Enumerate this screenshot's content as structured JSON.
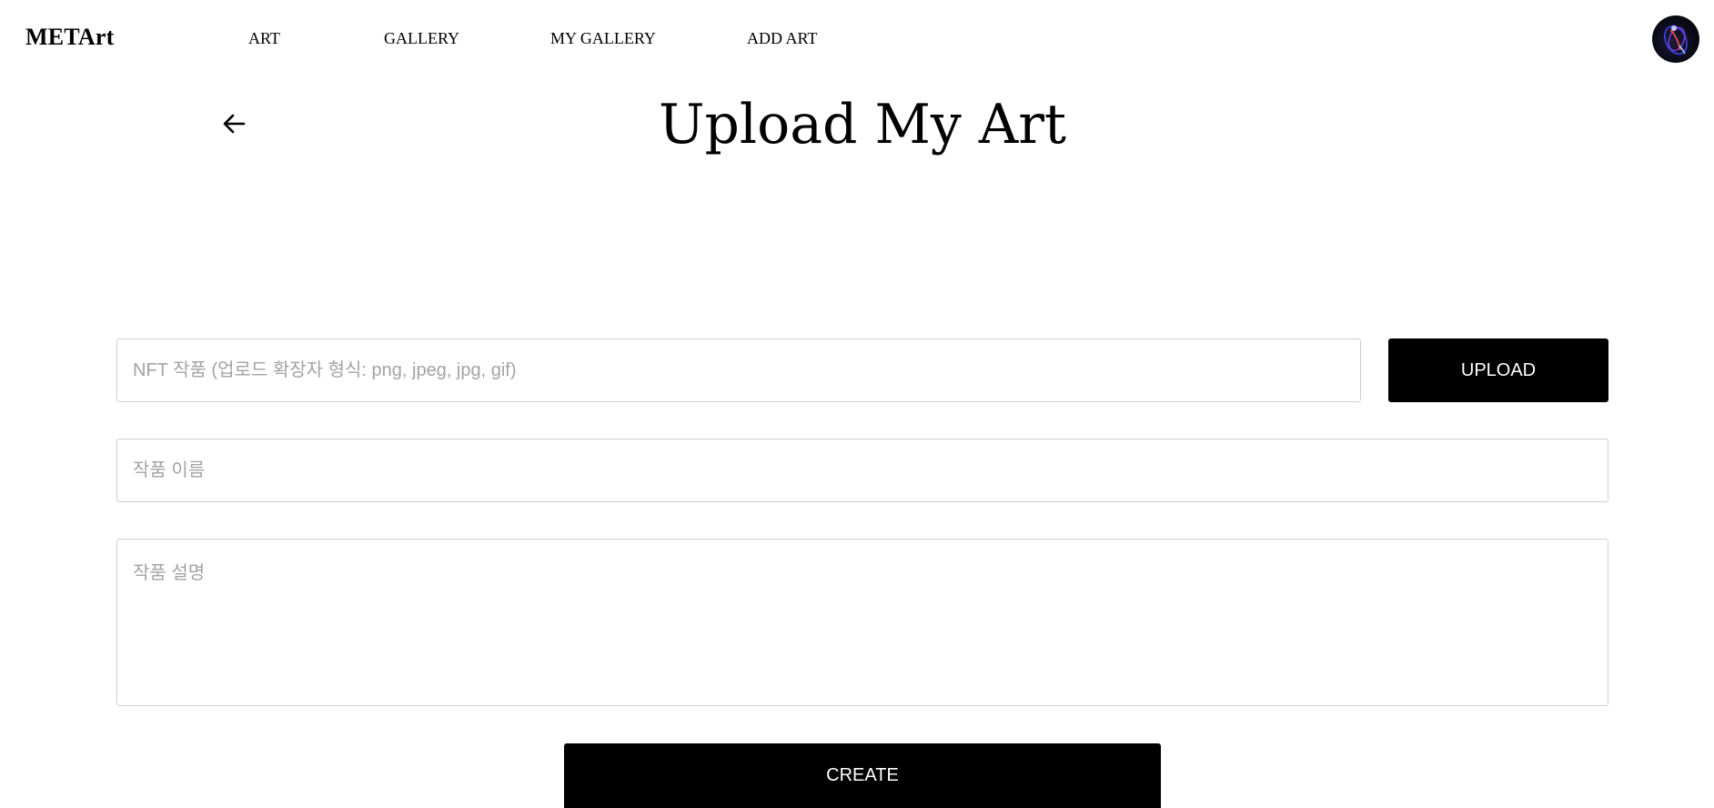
{
  "header": {
    "logo": "METArt",
    "nav": [
      {
        "label": "ART"
      },
      {
        "label": "GALLERY"
      },
      {
        "label": "MY GALLERY"
      },
      {
        "label": "ADD ART"
      }
    ],
    "avatar_icon": "profile-avatar"
  },
  "main": {
    "back_icon": "arrow-left-icon",
    "title": "Upload My Art",
    "form": {
      "file_placeholder": "NFT 작품 (업로드 확장자 형식: png, jpeg, jpg, gif)",
      "file_value": "",
      "upload_label": "UPLOAD",
      "name_placeholder": "작품 이름",
      "name_value": "",
      "description_placeholder": "작품 설명",
      "description_value": "",
      "create_label": "CREATE"
    }
  },
  "colors": {
    "button_bg": "#000000",
    "button_text": "#ffffff",
    "border": "#cfcfcf",
    "placeholder": "#a3a3a3"
  }
}
